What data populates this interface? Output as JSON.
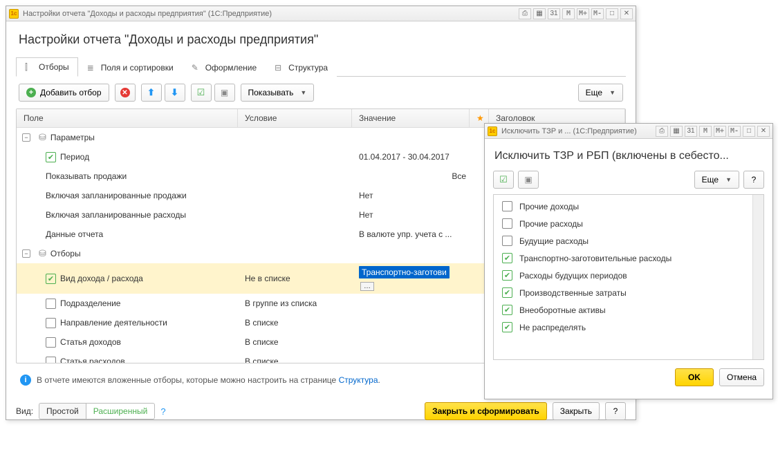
{
  "main": {
    "titlebar": "Настройки отчета \"Доходы и расходы предприятия\"  (1С:Предприятие)",
    "heading": "Настройки отчета \"Доходы и расходы предприятия\"",
    "tb_buttons": {
      "m": "M",
      "mplus": "M+",
      "mminus": "M-"
    },
    "tabs": {
      "filters": "Отборы",
      "fields": "Поля и сортировки",
      "design": "Оформление",
      "struct": "Структура"
    },
    "toolbar": {
      "add_filter": "Добавить отбор",
      "show": "Показывать",
      "more": "Еще"
    },
    "grid_head": {
      "field": "Поле",
      "cond": "Условие",
      "val": "Значение",
      "star": "★",
      "title": "Заголовок"
    },
    "groups": {
      "params": "Параметры",
      "filters": "Отборы"
    },
    "rows": {
      "period": {
        "label": "Период",
        "val": "01.04.2017 - 30.04.2017"
      },
      "sales": {
        "label": "Показывать продажи",
        "val": "Все"
      },
      "plan_sales": {
        "label": "Включая запланированные продажи",
        "val": "Нет"
      },
      "plan_exp": {
        "label": "Включая запланированные расходы",
        "val": "Нет"
      },
      "report_data": {
        "label": "Данные отчета",
        "val": "В валюте упр. учета с ..."
      },
      "kind": {
        "label": "Вид дохода / расхода",
        "cond": "Не в списке",
        "val": "Транспортно-заготови"
      },
      "dept": {
        "label": "Подразделение",
        "cond": "В группе из списка"
      },
      "direction": {
        "label": "Направление деятельности",
        "cond": "В списке"
      },
      "income_item": {
        "label": "Статья доходов",
        "cond": "В списке"
      },
      "expense_item": {
        "label": "Статья расходов",
        "cond": "В списке"
      }
    },
    "info": {
      "text_a": "В отчете имеются вложенные отборы, которые можно настроить на странице ",
      "link": "Структура",
      "text_b": "."
    },
    "footer": {
      "view_label": "Вид:",
      "simple": "Простой",
      "advanced": "Расширенный",
      "help": "?",
      "close_run": "Закрыть и сформировать",
      "close": "Закрыть",
      "help2": "?"
    }
  },
  "dialog": {
    "titlebar": "Исключить ТЗР и ...    (1С:Предприятие)",
    "heading": "Исключить ТЗР и РБП (включены в себесто...",
    "toolbar": {
      "more": "Еще",
      "help": "?"
    },
    "items": [
      {
        "checked": false,
        "label": "Прочие доходы"
      },
      {
        "checked": false,
        "label": "Прочие расходы"
      },
      {
        "checked": false,
        "label": "Будущие расходы"
      },
      {
        "checked": true,
        "label": "Транспортно-заготовительные расходы"
      },
      {
        "checked": true,
        "label": "Расходы будущих периодов"
      },
      {
        "checked": true,
        "label": "Производственные затраты"
      },
      {
        "checked": true,
        "label": "Внеоборотные активы"
      },
      {
        "checked": true,
        "label": "Не распределять"
      }
    ],
    "footer": {
      "ok": "OK",
      "cancel": "Отмена"
    }
  }
}
